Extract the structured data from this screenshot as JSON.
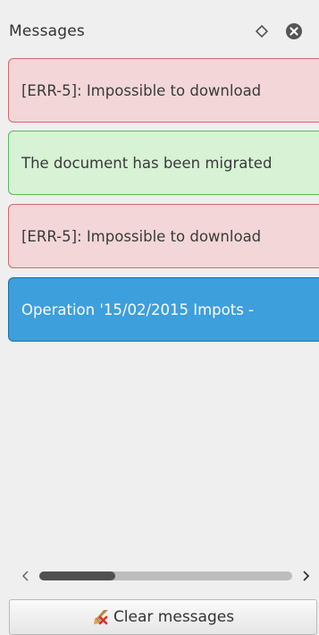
{
  "panel": {
    "title": "Messages"
  },
  "messages": [
    {
      "type": "error",
      "text": "[ERR-5]: Impossible to download"
    },
    {
      "type": "success",
      "text": "The document has been migrated"
    },
    {
      "type": "error",
      "text": "[ERR-5]: Impossible to download"
    },
    {
      "type": "info",
      "text": "Operation '15/02/2015  Impots -"
    }
  ],
  "scrollbar": {
    "position": 0,
    "visible_fraction": 0.3
  },
  "footer": {
    "clear_label": "Clear messages"
  },
  "colors": {
    "error_bg": "#f2d6d8",
    "error_border": "#d6666d",
    "success_bg": "#d7f2d5",
    "success_border": "#5cb85c",
    "info_bg": "#3d9fdc",
    "info_border": "#1f6fa3"
  },
  "icons": {
    "float": "diamond-icon",
    "close": "close-circle-icon",
    "scroll_left": "chevron-left-icon",
    "scroll_right": "chevron-right-icon",
    "clear": "broom-icon"
  }
}
